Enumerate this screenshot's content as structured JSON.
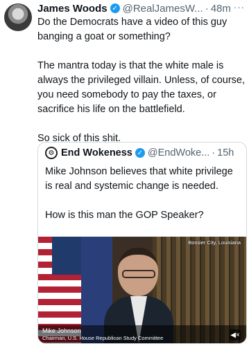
{
  "tweet": {
    "author_name": "James Woods",
    "handle": "@RealJamesW...",
    "separator": "·",
    "time": "48m",
    "more": "···",
    "paragraphs": [
      "Do the Democrats have a video of this guy banging a goat or something?",
      "The mantra today is that the white male is always the privileged villain. Unless, of course, you need somebody to pay the taxes, or sacrifice his life on the battlefield.",
      "So sick of this shit."
    ]
  },
  "quote": {
    "author_name": "End Wokeness",
    "handle": "@EndWoke...",
    "separator": "·",
    "time": "15h",
    "paragraphs": [
      "Mike Johnson believes that white privilege is real and systemic change is needed.",
      "How is this man the GOP Speaker?"
    ],
    "video": {
      "location": "Bossier City, Louisiana",
      "lower_third_name": "Mike Johnson",
      "lower_third_title": "Chairman, U.S. House Republican Study Committee",
      "mute_glyph": "◀×"
    }
  },
  "icons": {
    "verified": "✓"
  },
  "colors": {
    "verified": "#1d9bf0",
    "secondary_text": "#536471",
    "border": "#cfd9de"
  }
}
